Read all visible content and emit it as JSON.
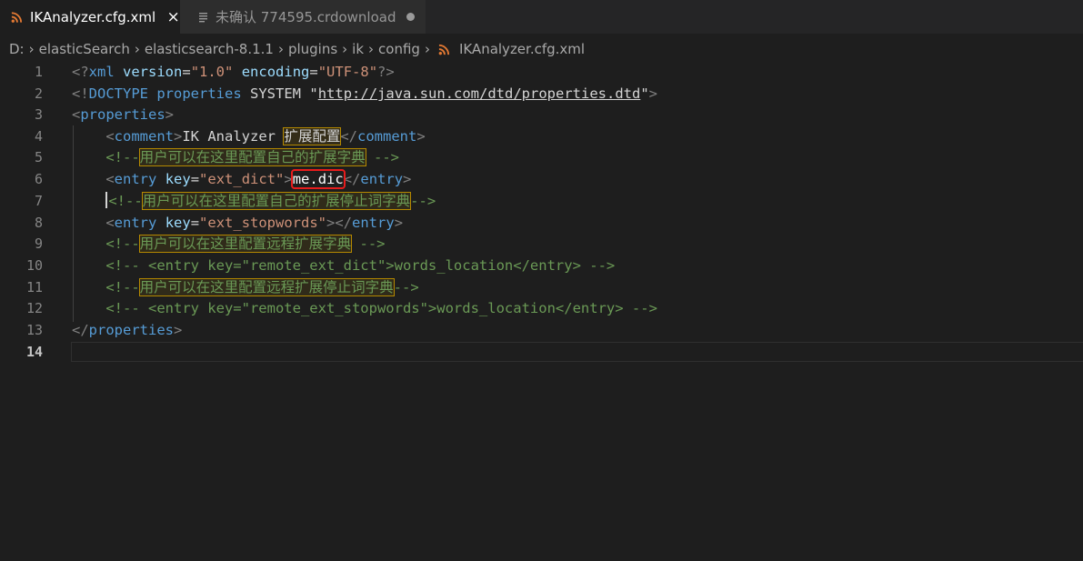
{
  "tabs": [
    {
      "label": "IKAnalyzer.cfg.xml",
      "icon": "rss-icon",
      "active": true,
      "action": "×"
    },
    {
      "label": "未确认 774595.crdownload",
      "icon": "file-lines-icon",
      "active": false
    }
  ],
  "breadcrumb": {
    "parts": [
      "D:",
      "elasticSearch",
      "elasticsearch-8.1.1",
      "plugins",
      "ik",
      "config"
    ],
    "file": "IKAnalyzer.cfg.xml"
  },
  "editor": {
    "current_line": 14,
    "lines": [
      {
        "n": "1",
        "text": "<?xml version=\"1.0\" encoding=\"UTF-8\"?>"
      },
      {
        "n": "2",
        "text": "<!DOCTYPE properties SYSTEM \"http://java.sun.com/dtd/properties.dtd\">"
      },
      {
        "n": "3",
        "text": "<properties>"
      },
      {
        "n": "4",
        "text": "    <comment>IK Analyzer 扩展配置</comment>"
      },
      {
        "n": "5",
        "text": "    <!--用户可以在这里配置自己的扩展字典 -->"
      },
      {
        "n": "6",
        "text": "    <entry key=\"ext_dict\">me.dic</entry>"
      },
      {
        "n": "7",
        "text": "     <!--用户可以在这里配置自己的扩展停止词字典-->"
      },
      {
        "n": "8",
        "text": "    <entry key=\"ext_stopwords\"></entry>"
      },
      {
        "n": "9",
        "text": "    <!--用户可以在这里配置远程扩展字典 -->"
      },
      {
        "n": "10",
        "text": "    <!-- <entry key=\"remote_ext_dict\">words_location</entry> -->"
      },
      {
        "n": "11",
        "text": "    <!--用户可以在这里配置远程扩展停止词字典-->"
      },
      {
        "n": "12",
        "text": "    <!-- <entry key=\"remote_ext_stopwords\">words_location</entry> -->"
      },
      {
        "n": "13",
        "text": "</properties>"
      },
      {
        "n": "14",
        "text": ""
      }
    ],
    "t": {
      "l1": {
        "a": "<?",
        "b": "xml",
        "c": "version",
        "d": "=",
        "e": "\"1.0\"",
        "f": "encoding",
        "g": "\"UTF-8\"",
        "h": "?>"
      },
      "l2": {
        "a": "<!",
        "b": "DOCTYPE",
        "c": "properties",
        "d": "SYSTEM",
        "e": "\"",
        "f": "http://java.sun.com/dtd/properties.dtd",
        "g": "\"",
        "h": ">"
      },
      "l3": {
        "a": "<",
        "b": "properties",
        "c": ">"
      },
      "l4": {
        "a": "<",
        "b": "comment",
        "c": ">",
        "d": "IK Analyzer ",
        "e": "扩展配置",
        "f": "</",
        "g": "comment",
        "h": ">"
      },
      "l5": {
        "a": "<!--",
        "b": "用户可以在这里配置自己的扩展字典",
        "c": " -->"
      },
      "l6": {
        "a": "<",
        "b": "entry",
        "c": "key",
        "d": "=",
        "e": "\"ext_dict\"",
        "f": ">",
        "g": "me.dic",
        "h": "</",
        "i": "entry",
        "j": ">"
      },
      "l7": {
        "a": "<!--",
        "b": "用户可以在这里配置自己的扩展停止词字典",
        "c": "-->"
      },
      "l8": {
        "a": "<",
        "b": "entry",
        "c": "key",
        "d": "=",
        "e": "\"ext_stopwords\"",
        "f": "></",
        "g": "entry",
        "h": ">"
      },
      "l9": {
        "a": "<!--",
        "b": "用户可以在这里配置远程扩展字典",
        "c": " -->"
      },
      "l10": {
        "a": "<!-- <entry key=\"remote_ext_dict\">words_location</entry> -->"
      },
      "l11": {
        "a": "<!--",
        "b": "用户可以在这里配置远程扩展停止词字典",
        "c": "-->"
      },
      "l12": {
        "a": "<!-- <entry key=\"remote_ext_stopwords\">words_location</entry> -->"
      },
      "l13": {
        "a": "</",
        "b": "properties",
        "c": ">"
      }
    }
  },
  "colors": {
    "background": "#1e1e1e",
    "tag": "#569cd6",
    "attribute": "#9cdcfe",
    "string": "#ce9178",
    "comment": "#6a9955",
    "highlight_outline": "#b58900",
    "annotation_box": "#e81c1c"
  }
}
